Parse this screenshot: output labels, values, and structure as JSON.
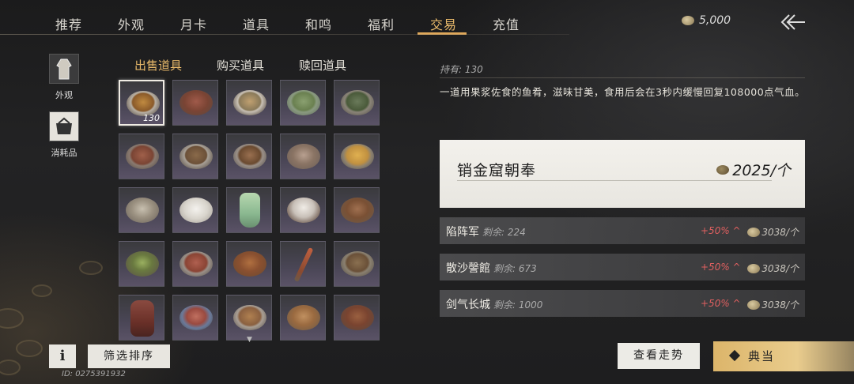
{
  "nav": {
    "tabs": [
      {
        "label": "推荐"
      },
      {
        "label": "外观"
      },
      {
        "label": "月卡"
      },
      {
        "label": "道具"
      },
      {
        "label": "和鸣"
      },
      {
        "label": "福利"
      },
      {
        "label": "交易"
      },
      {
        "label": "充值"
      }
    ],
    "active_index": 6,
    "currency_amount": "5,000",
    "back_icon": "back-arrow-icon"
  },
  "categories": [
    {
      "label": "外观",
      "icon": "outfit-icon"
    },
    {
      "label": "消耗品",
      "icon": "consumable-icon"
    }
  ],
  "sub_tabs": [
    {
      "label": "出售道具"
    },
    {
      "label": "购买道具"
    },
    {
      "label": "赎回道具"
    }
  ],
  "items": {
    "selected_qty": "130"
  },
  "detail": {
    "owned_text": "持有: 130",
    "description": "一道用果浆佐食的鱼肴，滋味甘美，食用后会在3秒内缓慢回复108000点气血。",
    "main_offer": {
      "name": "销金窟朝奉",
      "price": "2025/个"
    },
    "offers": [
      {
        "name": "陷阵军",
        "remain": "剩余: 224",
        "pct": "+50% ^",
        "price": "3038/个"
      },
      {
        "name": "散沙謦館",
        "remain": "剩余: 673",
        "pct": "+50% ^",
        "price": "3038/个"
      },
      {
        "name": "剑气长城",
        "remain": "剩余: 1000",
        "pct": "+50% ^",
        "price": "3038/个"
      }
    ]
  },
  "bottom": {
    "info_label": "i",
    "filter_label": "筛选排序",
    "uid": "ID: 0275391932",
    "trend_label": "查看走势",
    "pawn_label": "典当"
  },
  "colors": {
    "accent": "#e8b96a",
    "increase": "#e06060",
    "pawn_button": "#dcb56a"
  }
}
